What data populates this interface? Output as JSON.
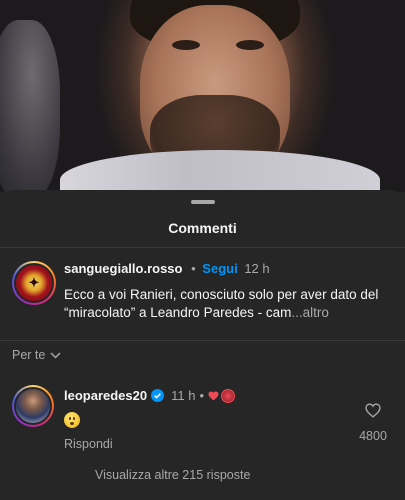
{
  "sheet": {
    "title": "Commenti"
  },
  "caption": {
    "username": "sanguegiallo.rosso",
    "follow_label": "Segui",
    "time": "12 h",
    "text": "Ecco a voi Ranieri, conosciuto solo per aver dato del “miracolato” a Leandro Paredes - cam",
    "more_label": "...altro",
    "avatar_icon": "club-crest-icon"
  },
  "filter": {
    "label": "Per te",
    "icon": "chevron-down-icon"
  },
  "comments": [
    {
      "username": "leoparedes20",
      "verified": true,
      "time": "11 h",
      "bullet": "•",
      "content_emoji": "😶",
      "reply_label": "Rispondi",
      "like_count": "4800",
      "liked_by_author": true,
      "view_replies_label": "Visualizza altre 215 risposte"
    }
  ],
  "colors": {
    "background": "#262626",
    "accent": "#0095f6",
    "muted": "#a8a8a8",
    "heart": "#ed4956"
  }
}
